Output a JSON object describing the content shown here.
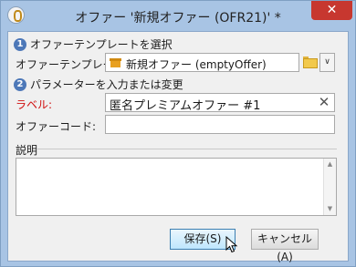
{
  "window": {
    "title": "オファー '新規オファー (OFR21)' *",
    "close_glyph": "✕"
  },
  "step1": {
    "number": "1",
    "text": "オファーテンプレートを選択"
  },
  "template": {
    "label": "オファーテンプレート:",
    "value": "新規オファー (emptyOffer)",
    "dropdown_glyph": "∨"
  },
  "step2": {
    "number": "2",
    "text": "パラメーターを入力または変更"
  },
  "label_field": {
    "label": "ラベル:",
    "value": "匿名プレミアムオファー #1",
    "clear_glyph": "✕"
  },
  "code_field": {
    "label": "オファーコード:",
    "value": ""
  },
  "description": {
    "label": "説明",
    "value": ""
  },
  "buttons": {
    "save": "保存(S)",
    "cancel": "キャンセル(A)"
  },
  "colors": {
    "frame": "#a8c4e4",
    "close": "#c7372f",
    "step_badge": "#4d78b8",
    "required_label": "#d01010"
  }
}
